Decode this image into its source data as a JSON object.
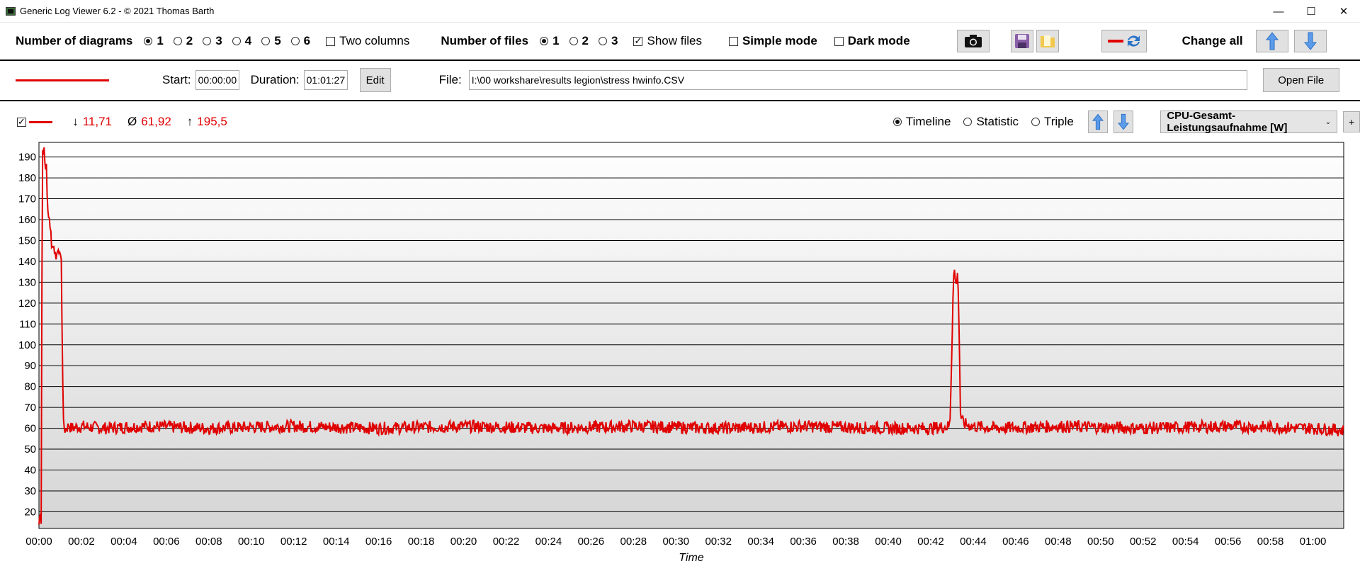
{
  "window": {
    "title": "Generic Log Viewer 6.2 - © 2021 Thomas Barth",
    "minimize": "—",
    "maximize": "☐",
    "close": "✕"
  },
  "toolbar": {
    "diagrams_label": "Number of diagrams",
    "diagram_options": [
      "1",
      "2",
      "3",
      "4",
      "5",
      "6"
    ],
    "diagram_selected": "1",
    "two_columns_label": "Two columns",
    "files_label": "Number of files",
    "file_options": [
      "1",
      "2",
      "3"
    ],
    "file_selected": "1",
    "show_files_label": "Show files",
    "simple_mode_label": "Simple mode",
    "dark_mode_label": "Dark mode",
    "change_all_label": "Change all"
  },
  "file_row": {
    "start_label": "Start:",
    "start_value": "00:00:00",
    "duration_label": "Duration:",
    "duration_value": "01:01:27",
    "edit_label": "Edit",
    "file_label": "File:",
    "file_path": "I:\\00 workshare\\results legion\\stress hwinfo.CSV",
    "open_file_label": "Open File",
    "line_color": "#e00000"
  },
  "diagram_header": {
    "min_symbol": "↓",
    "min_value": "11,71",
    "avg_symbol": "Ø",
    "avg_value": "61,92",
    "max_symbol": "↑",
    "max_value": "195,5",
    "modes": [
      "Timeline",
      "Statistic",
      "Triple"
    ],
    "mode_selected": "Timeline",
    "sensor": "CPU-Gesamt-Leistungsaufnahme [W]",
    "add_label": "+"
  },
  "chart_data": {
    "type": "line",
    "xlabel": "Time",
    "ylabel": "",
    "title": "",
    "ylim": [
      12,
      197
    ],
    "xlim_minutes": [
      0,
      61.45
    ],
    "y_ticks": [
      20,
      30,
      40,
      50,
      60,
      70,
      80,
      90,
      100,
      110,
      120,
      130,
      140,
      150,
      160,
      170,
      180,
      190
    ],
    "x_tick_labels": [
      "00:00",
      "00:02",
      "00:04",
      "00:06",
      "00:08",
      "00:10",
      "00:12",
      "00:14",
      "00:16",
      "00:18",
      "00:20",
      "00:22",
      "00:24",
      "00:26",
      "00:28",
      "00:30",
      "00:32",
      "00:34",
      "00:36",
      "00:38",
      "00:40",
      "00:42",
      "00:44",
      "00:46",
      "00:48",
      "00:50",
      "00:52",
      "00:54",
      "00:56",
      "00:58",
      "01:00"
    ],
    "x_tick_minutes": [
      0,
      2,
      4,
      6,
      8,
      10,
      12,
      14,
      16,
      18,
      20,
      22,
      24,
      26,
      28,
      30,
      32,
      34,
      36,
      38,
      40,
      42,
      44,
      46,
      48,
      50,
      52,
      54,
      56,
      58,
      60
    ],
    "series": [
      {
        "color": "#e00000",
        "x_minutes": [
          0,
          0.08,
          0.12,
          0.15,
          0.2,
          0.25,
          0.3,
          0.35,
          0.4,
          0.45,
          0.5,
          0.55,
          0.6,
          0.65,
          0.7,
          0.75,
          0.8,
          0.85,
          0.9,
          0.95,
          1.0,
          1.05,
          1.1,
          1.15,
          1.2,
          1.25,
          1.3,
          1.35,
          1.4,
          1.5,
          2,
          3,
          5,
          8,
          12,
          16,
          20,
          24,
          28,
          32,
          36,
          40,
          42,
          42.9,
          43.0,
          43.05,
          43.1,
          43.15,
          43.2,
          43.25,
          43.3,
          43.35,
          43.4,
          43.45,
          43.5,
          43.6,
          44,
          45,
          48,
          52,
          56,
          60,
          61.45
        ],
        "values": [
          14,
          22,
          12,
          190,
          195,
          192,
          183,
          188,
          163,
          164,
          160,
          155,
          148,
          146,
          149,
          145,
          137,
          148,
          142,
          146,
          144,
          140,
          100,
          62,
          60,
          59,
          61,
          60,
          62,
          60,
          61,
          60,
          61,
          60,
          61,
          60,
          61,
          60,
          61,
          60,
          61,
          60,
          60,
          61,
          100,
          125,
          137,
          132,
          128,
          134,
          127,
          100,
          68,
          64,
          63,
          62,
          61,
          60,
          61,
          60,
          61,
          60,
          59
        ]
      }
    ],
    "noise_amplitude": 3,
    "grid": true
  }
}
